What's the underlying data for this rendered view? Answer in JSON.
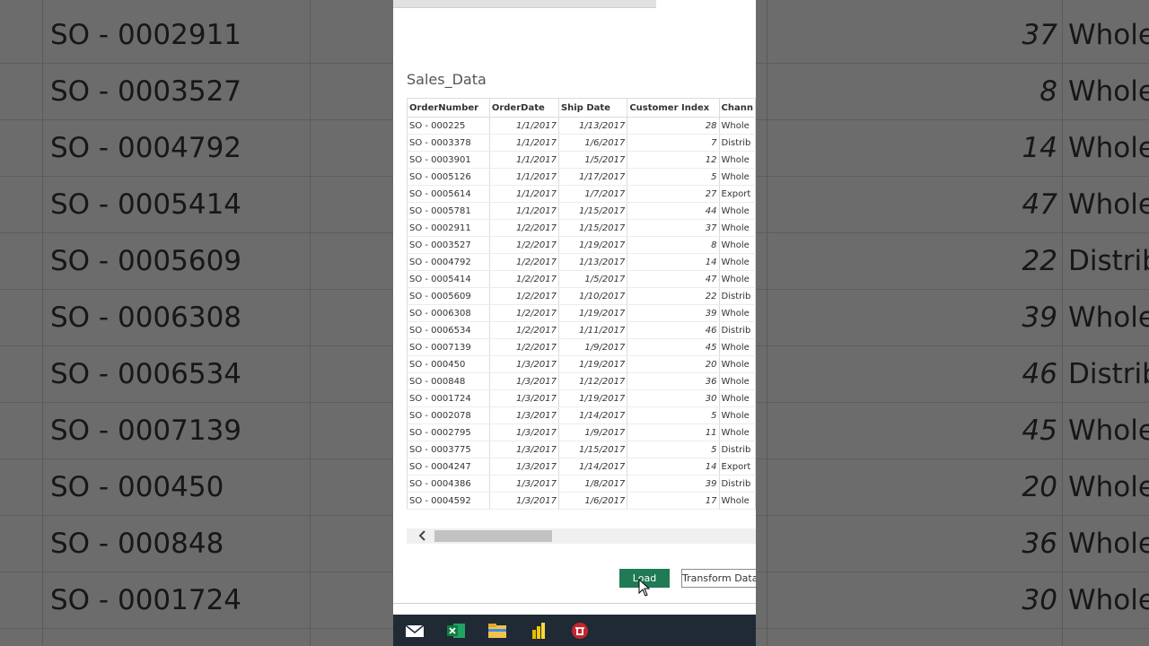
{
  "background": {
    "orders": [
      "SO - 0002911",
      "SO - 0003527",
      "SO - 0004792",
      "SO - 0005414",
      "SO - 0005609",
      "SO - 0006308",
      "SO - 0006534",
      "SO - 0007139",
      "SO - 000450",
      "SO - 000848",
      "SO - 0001724"
    ],
    "index": [
      "37",
      "8",
      "14",
      "47",
      "22",
      "39",
      "46",
      "45",
      "20",
      "36",
      "30"
    ],
    "channels": [
      "Whole",
      "Whole",
      "Whole",
      "Whole",
      "Distrib",
      "Whole",
      "Distrib",
      "Whole",
      "Whole",
      "Whole",
      "Whole"
    ]
  },
  "dialog": {
    "title": "Sales_Data",
    "columns": [
      "OrderNumber",
      "OrderDate",
      "Ship Date",
      "Customer Index",
      "Chann"
    ],
    "rows": [
      [
        "SO - 000225",
        "1/1/2017",
        "1/13/2017",
        "28",
        "Whole"
      ],
      [
        "SO - 0003378",
        "1/1/2017",
        "1/6/2017",
        "7",
        "Distrib"
      ],
      [
        "SO - 0003901",
        "1/1/2017",
        "1/5/2017",
        "12",
        "Whole"
      ],
      [
        "SO - 0005126",
        "1/1/2017",
        "1/17/2017",
        "5",
        "Whole"
      ],
      [
        "SO - 0005614",
        "1/1/2017",
        "1/7/2017",
        "27",
        "Export"
      ],
      [
        "SO - 0005781",
        "1/1/2017",
        "1/15/2017",
        "44",
        "Whole"
      ],
      [
        "SO - 0002911",
        "1/2/2017",
        "1/15/2017",
        "37",
        "Whole"
      ],
      [
        "SO - 0003527",
        "1/2/2017",
        "1/19/2017",
        "8",
        "Whole"
      ],
      [
        "SO - 0004792",
        "1/2/2017",
        "1/13/2017",
        "14",
        "Whole"
      ],
      [
        "SO - 0005414",
        "1/2/2017",
        "1/5/2017",
        "47",
        "Whole"
      ],
      [
        "SO - 0005609",
        "1/2/2017",
        "1/10/2017",
        "22",
        "Distrib"
      ],
      [
        "SO - 0006308",
        "1/2/2017",
        "1/19/2017",
        "39",
        "Whole"
      ],
      [
        "SO - 0006534",
        "1/2/2017",
        "1/11/2017",
        "46",
        "Distrib"
      ],
      [
        "SO - 0007139",
        "1/2/2017",
        "1/9/2017",
        "45",
        "Whole"
      ],
      [
        "SO - 000450",
        "1/3/2017",
        "1/19/2017",
        "20",
        "Whole"
      ],
      [
        "SO - 000848",
        "1/3/2017",
        "1/12/2017",
        "36",
        "Whole"
      ],
      [
        "SO - 0001724",
        "1/3/2017",
        "1/19/2017",
        "30",
        "Whole"
      ],
      [
        "SO - 0002078",
        "1/3/2017",
        "1/14/2017",
        "5",
        "Whole"
      ],
      [
        "SO - 0002795",
        "1/3/2017",
        "1/9/2017",
        "11",
        "Whole"
      ],
      [
        "SO - 0003775",
        "1/3/2017",
        "1/15/2017",
        "5",
        "Distrib"
      ],
      [
        "SO - 0004247",
        "1/3/2017",
        "1/14/2017",
        "14",
        "Export"
      ],
      [
        "SO - 0004386",
        "1/3/2017",
        "1/8/2017",
        "39",
        "Distrib"
      ],
      [
        "SO - 0004592",
        "1/3/2017",
        "1/6/2017",
        "17",
        "Whole"
      ]
    ],
    "load_label": "Load",
    "transform_label": "Transform Data",
    "scroll_left_icon": "chevron-left-icon"
  },
  "taskbar": {
    "icons": [
      "mail-icon",
      "excel-icon",
      "file-explorer-icon",
      "power-bi-icon",
      "app-icon"
    ]
  },
  "colors": {
    "load_button": "#1f7a55",
    "taskbar": "#1f2a35",
    "overlay": "#4b4b4b"
  }
}
